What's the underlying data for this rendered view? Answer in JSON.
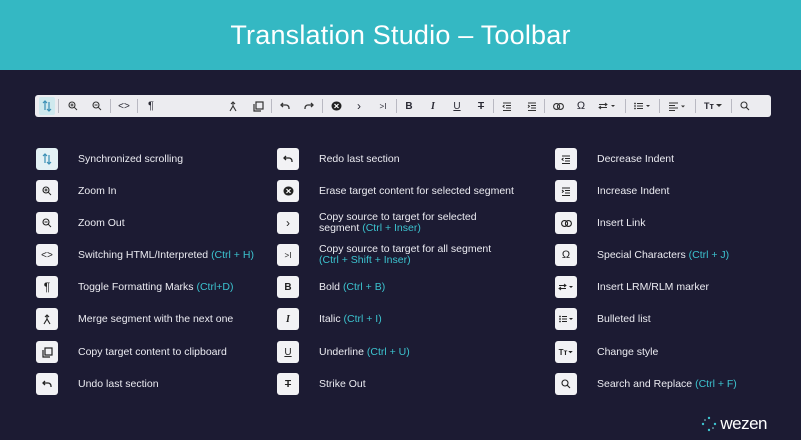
{
  "header": {
    "title": "Translation Studio – Toolbar"
  },
  "toolbar": {
    "zoom_in": "⊕",
    "zoom_out": "⊖",
    "html": "<>",
    "pilcrow": "¶",
    "redo": "↷",
    "undo": "↶",
    "copy_one": "›",
    "copy_all": ">I",
    "bold": "B",
    "italic": "I",
    "underline": "U",
    "strike": "T",
    "omega": "Ω",
    "style": "Tт",
    "search": "⌕"
  },
  "legend": {
    "col1": [
      {
        "icon": "sync-scroll-icon",
        "glyph": "⇅",
        "text": "Synchronized scrolling",
        "shortcut": ""
      },
      {
        "icon": "zoom-in-icon",
        "glyph": "⊕",
        "text": "Zoom In",
        "shortcut": ""
      },
      {
        "icon": "zoom-out-icon",
        "glyph": "⊖",
        "text": "Zoom Out",
        "shortcut": ""
      },
      {
        "icon": "html-icon",
        "glyph": "<>",
        "text": "Switching HTML/Interpreted",
        "shortcut": "(Ctrl + H)"
      },
      {
        "icon": "pilcrow-icon",
        "glyph": "¶",
        "text": "Toggle Formatting Marks",
        "shortcut": "(Ctrl+D)"
      },
      {
        "icon": "merge-icon",
        "glyph": "⨯",
        "text": "Merge segment with the next one",
        "shortcut": ""
      },
      {
        "icon": "copy-icon",
        "glyph": "⧉",
        "text": "Copy target content to clipboard",
        "shortcut": ""
      },
      {
        "icon": "undo-icon",
        "glyph": "↶",
        "text": "Undo last section",
        "shortcut": ""
      }
    ],
    "col2": [
      {
        "icon": "redo-icon",
        "glyph": "↷",
        "text": "Redo last section",
        "shortcut": "",
        "sub": ""
      },
      {
        "icon": "erase-icon",
        "glyph": "⌫",
        "text": "Erase target content for selected segment",
        "shortcut": "",
        "sub": ""
      },
      {
        "icon": "copy-source-icon",
        "glyph": "›",
        "text": "Copy source to target for selected",
        "sub": "segment",
        "shortcut": "(Ctrl + Inser)"
      },
      {
        "icon": "copy-all-icon",
        "glyph": ">I",
        "text": "Copy source to target for all segment",
        "sub": "",
        "shortcut": "(Ctrl + Shift + Inser)"
      },
      {
        "icon": "bold-icon",
        "glyph": "B",
        "text": "Bold",
        "shortcut": "(Ctrl + B)",
        "sub": ""
      },
      {
        "icon": "italic-icon",
        "glyph": "I",
        "text": "Italic",
        "shortcut": "(Ctrl + I)",
        "sub": ""
      },
      {
        "icon": "underline-icon",
        "glyph": "U",
        "text": "Underline",
        "shortcut": "(Ctrl + U)",
        "sub": ""
      },
      {
        "icon": "strike-icon",
        "glyph": "T",
        "text": "Strike Out",
        "shortcut": "",
        "sub": ""
      }
    ],
    "col3": [
      {
        "icon": "decrease-indent-icon",
        "glyph": "≡",
        "text": "Decrease Indent",
        "shortcut": ""
      },
      {
        "icon": "increase-indent-icon",
        "glyph": "≡",
        "text": "Increase Indent",
        "shortcut": ""
      },
      {
        "icon": "link-icon",
        "glyph": "∞",
        "text": "Insert Link",
        "shortcut": ""
      },
      {
        "icon": "omega-icon",
        "glyph": "Ω",
        "text": "Special Characters",
        "shortcut": "(Ctrl + J)"
      },
      {
        "icon": "lrm-icon",
        "glyph": "⇄▾",
        "text": "Insert LRM/RLM marker",
        "shortcut": ""
      },
      {
        "icon": "bullet-list-icon",
        "glyph": "☰▾",
        "text": "Bulleted list",
        "shortcut": ""
      },
      {
        "icon": "style-icon",
        "glyph": "Tᴛ▾",
        "text": "Change style",
        "shortcut": ""
      },
      {
        "icon": "search-icon",
        "glyph": "⌕",
        "text": "Search and Replace",
        "shortcut": "(Ctrl + F)"
      }
    ]
  },
  "logo": {
    "text": "wezen"
  },
  "colors": {
    "header": "#34b8c3",
    "background": "#1c1b33",
    "shortcut": "#3cc3cf"
  }
}
